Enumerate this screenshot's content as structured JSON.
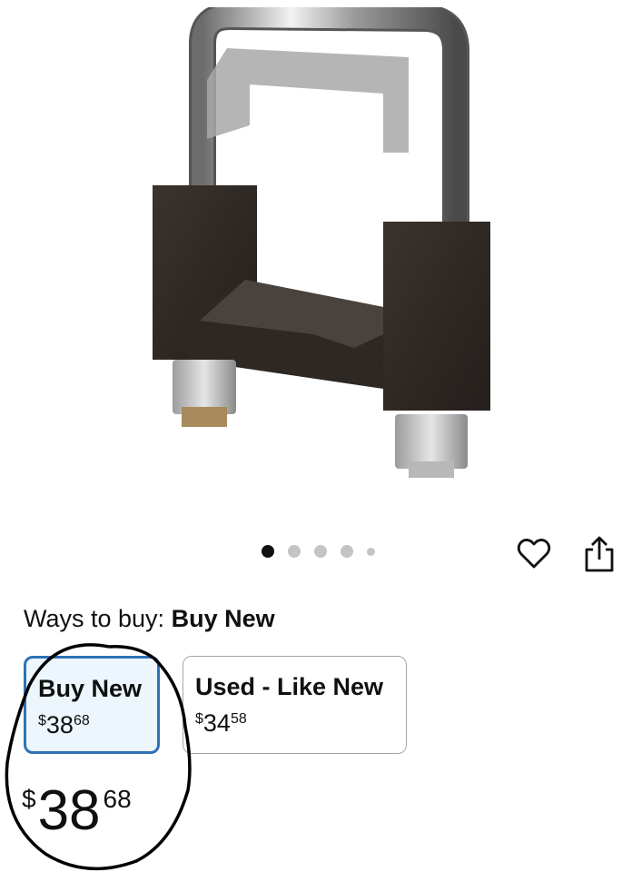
{
  "product": {
    "image_icon": "hitch-clamp-image"
  },
  "carousel": {
    "total_dots": 5,
    "active_index": 0
  },
  "actions": {
    "favorite_icon": "heart-icon",
    "share_icon": "share-icon"
  },
  "ways_to_buy": {
    "label": "Ways to buy:",
    "selected": "Buy New"
  },
  "options": [
    {
      "label": "Buy New",
      "price_currency": "$",
      "price_whole": "38",
      "price_fraction": "68",
      "selected": true
    },
    {
      "label": "Used - Like New",
      "price_currency": "$",
      "price_whole": "34",
      "price_fraction": "58",
      "selected": false
    }
  ],
  "price": {
    "currency": "$",
    "whole": "38",
    "fraction": "68"
  },
  "colors": {
    "selected_border": "#2d72b8",
    "selected_bg": "#edf6fd",
    "text": "#0f1111"
  }
}
